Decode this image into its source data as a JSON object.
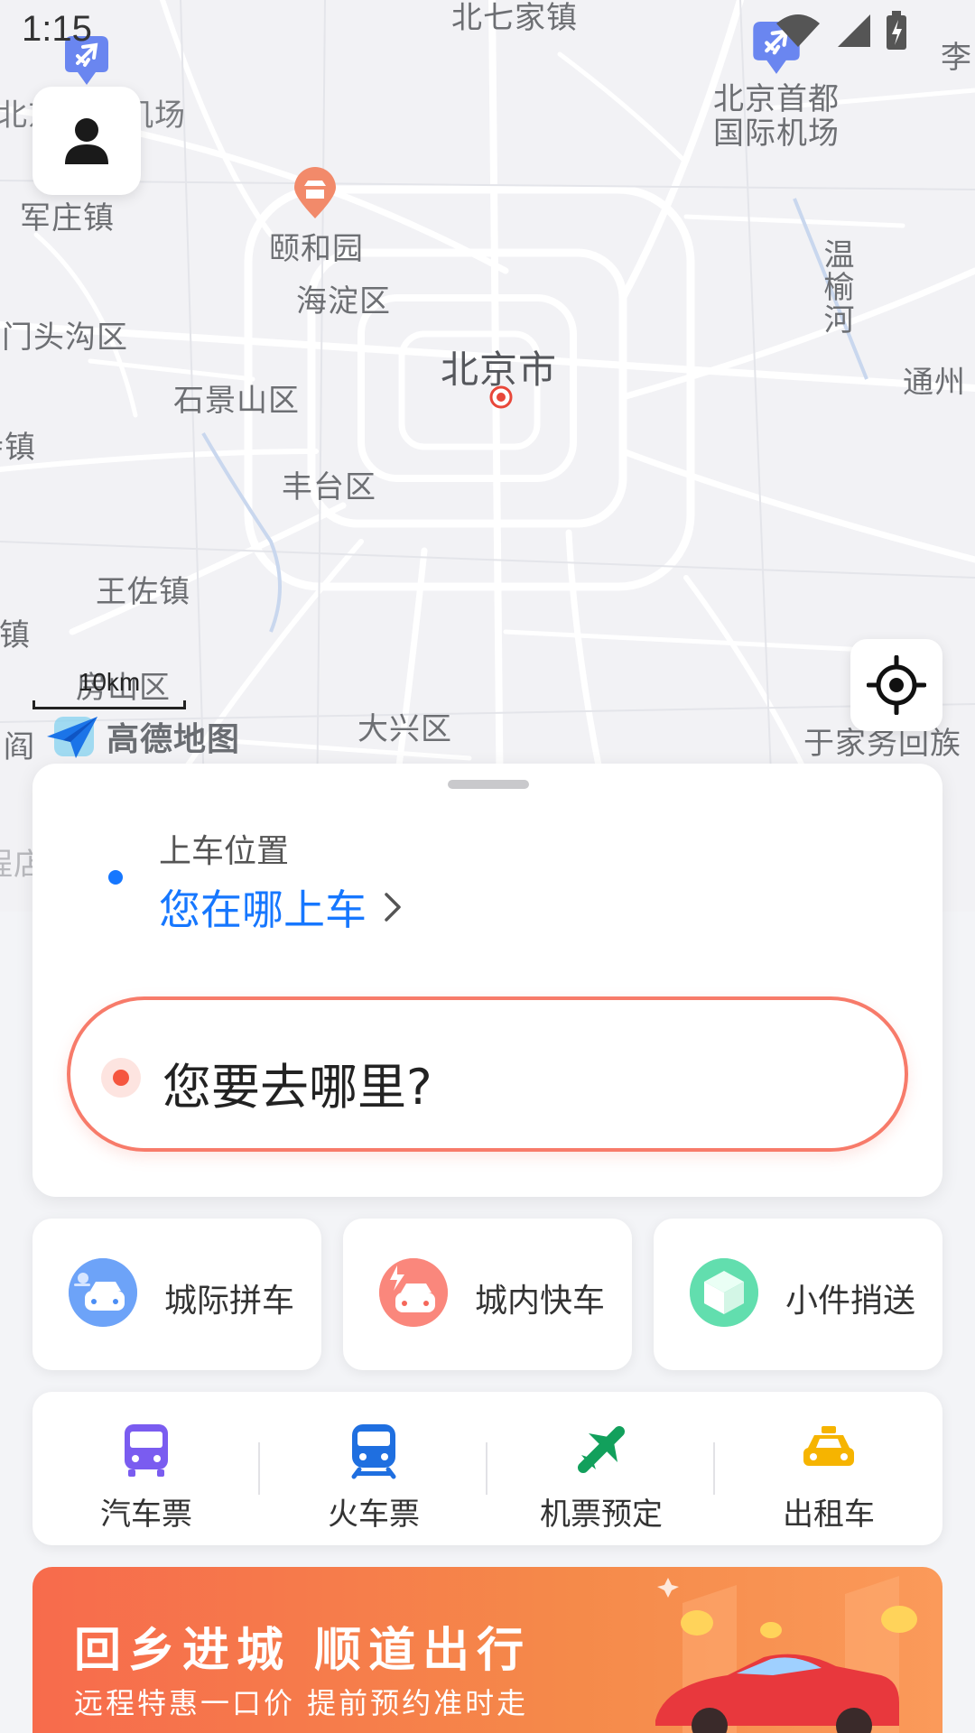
{
  "status_bar": {
    "time": "1:15"
  },
  "map": {
    "labels": {
      "beiqijiazhen": "北七家镇",
      "airport_left": "北京首都机场",
      "capital_airport_1": "北京首都",
      "capital_airport_2": "国际机场",
      "li": "李",
      "junzhuang": "军庄镇",
      "yiheyuan": "颐和园",
      "haidian": "海淀区",
      "wenyuhe": "温榆河",
      "mentougou": "门头沟区",
      "beijing": "北京市",
      "shijingshan": "石景山区",
      "tongzhou": "通州",
      "zhen_left": "寺镇",
      "fengtai": "丰台区",
      "wangzuo": "王佐镇",
      "hu_zhen": "湖镇",
      "fangshan": "房山区",
      "daxing": "大兴区",
      "yujiawu": "于家务回族",
      "yan": "阎",
      "dian": "程店"
    },
    "scale_text": "10km",
    "provider_name": "高德地图"
  },
  "pickup": {
    "label": "上车位置",
    "action": "您在哪上车"
  },
  "destination": {
    "placeholder": "您要去哪里?"
  },
  "services": [
    {
      "label": "城际拼车",
      "icon": "carpool-icon"
    },
    {
      "label": "城内快车",
      "icon": "express-car-icon"
    },
    {
      "label": "小件捎送",
      "icon": "parcel-icon"
    }
  ],
  "tickets": [
    {
      "label": "汽车票",
      "icon": "bus-icon"
    },
    {
      "label": "火车票",
      "icon": "train-icon"
    },
    {
      "label": "机票预定",
      "icon": "plane-icon"
    },
    {
      "label": "出租车",
      "icon": "taxi-icon"
    }
  ],
  "banner": {
    "title": "回乡进城 顺道出行",
    "subtitle": "远程特惠一口价  提前预约准时走"
  },
  "colors": {
    "accent_blue": "#1677ff",
    "accent_red": "#f5563f",
    "bus": "#7a5cf0",
    "train": "#1f6fe0",
    "plane": "#12a05c",
    "taxi": "#f6b400"
  }
}
